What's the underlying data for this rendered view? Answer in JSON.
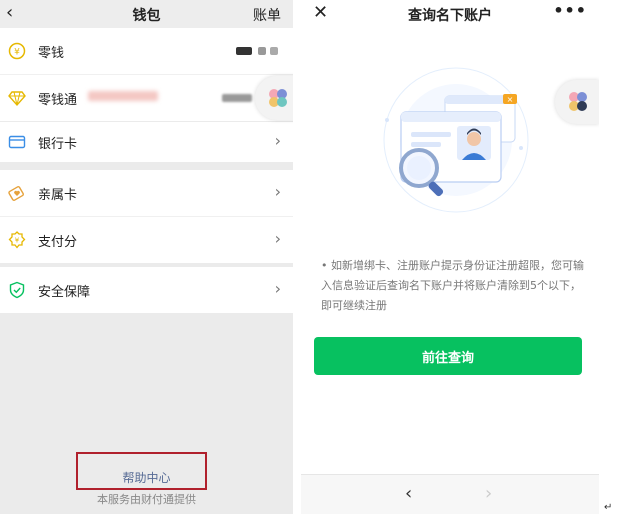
{
  "left": {
    "header": {
      "back_icon": "chevron-left-icon",
      "title": "钱包",
      "bill_label": "账单"
    },
    "items": [
      {
        "label": "零钱",
        "icon": "coin-icon",
        "color": "#e6b800"
      },
      {
        "label": "零钱通",
        "icon": "diamond-icon",
        "color": "#e6b800"
      },
      {
        "label": "银行卡",
        "icon": "card-icon",
        "color": "#3a8ee6"
      },
      {
        "label": "亲属卡",
        "icon": "heart-card-icon",
        "color": "#e6a23c"
      },
      {
        "label": "支付分",
        "icon": "badge-icon",
        "color": "#e6b800"
      },
      {
        "label": "安全保障",
        "icon": "shield-icon",
        "color": "#07c160"
      }
    ],
    "footer": {
      "help_label": "帮助中心",
      "service_note": "本服务由财付通提供"
    }
  },
  "right": {
    "header": {
      "close_icon": "close-icon",
      "title": "查询名下账户",
      "more_icon": "more-icon"
    },
    "tip": "• 如新增绑卡、注册账户提示身份证注册超限，您可输入信息验证后查询名下账户并将账户清除到5个以下，即可继续注册",
    "button_label": "前往查询",
    "nav": {
      "back_icon": "chevron-left-icon",
      "forward_icon": "chevron-right-icon"
    }
  },
  "colors": {
    "accent": "#07c160",
    "link": "#576b95",
    "highlight_box": "#b0202c"
  }
}
